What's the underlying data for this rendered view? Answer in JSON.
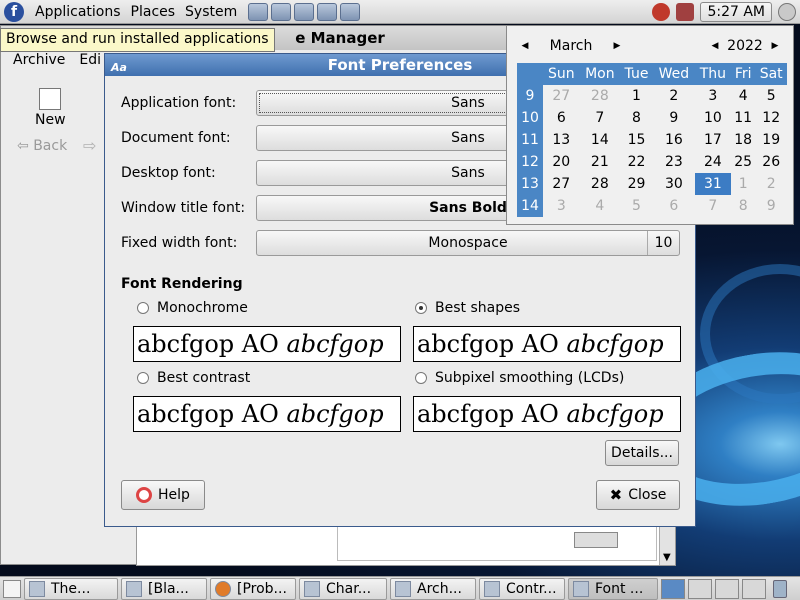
{
  "top_panel": {
    "menus": [
      "Applications",
      "Places",
      "System"
    ],
    "launcher_icons": [
      "web-browser-icon",
      "mail-icon",
      "editor-icon",
      "screen-icon",
      "network-icon"
    ],
    "clock": "5:27 AM"
  },
  "tooltip": "Browse and run installed applications",
  "background_window": {
    "title": "e Manager",
    "menus": [
      "Archive",
      "Edi"
    ],
    "new_label": "New",
    "back_label": "Back"
  },
  "calendar": {
    "month": "March",
    "year": "2022",
    "day_headers": [
      "Sun",
      "Mon",
      "Tue",
      "Wed",
      "Thu",
      "Fri",
      "Sat"
    ],
    "weeks": [
      {
        "num": "9",
        "days": [
          "27",
          "28",
          "1",
          "2",
          "3",
          "4",
          "5"
        ],
        "dim": [
          true,
          true,
          false,
          false,
          false,
          false,
          false
        ]
      },
      {
        "num": "10",
        "days": [
          "6",
          "7",
          "8",
          "9",
          "10",
          "11",
          "12"
        ],
        "dim": [
          false,
          false,
          false,
          false,
          false,
          false,
          false
        ]
      },
      {
        "num": "11",
        "days": [
          "13",
          "14",
          "15",
          "16",
          "17",
          "18",
          "19"
        ],
        "dim": [
          false,
          false,
          false,
          false,
          false,
          false,
          false
        ]
      },
      {
        "num": "12",
        "days": [
          "20",
          "21",
          "22",
          "23",
          "24",
          "25",
          "26"
        ],
        "dim": [
          false,
          false,
          false,
          false,
          false,
          false,
          false
        ]
      },
      {
        "num": "13",
        "days": [
          "27",
          "28",
          "29",
          "30",
          "31",
          "1",
          "2"
        ],
        "dim": [
          false,
          false,
          false,
          false,
          false,
          true,
          true
        ]
      },
      {
        "num": "14",
        "days": [
          "3",
          "4",
          "5",
          "6",
          "7",
          "8",
          "9"
        ],
        "dim": [
          true,
          true,
          true,
          true,
          true,
          true,
          true
        ]
      }
    ],
    "selected_day": "31"
  },
  "dialog": {
    "title": "Font Preferences",
    "fonts": [
      {
        "label": "Application font:",
        "value": "Sans"
      },
      {
        "label": "Document font:",
        "value": "Sans"
      },
      {
        "label": "Desktop font:",
        "value": "Sans"
      },
      {
        "label": "Window title font:",
        "value": "Sans Bold"
      },
      {
        "label": "Fixed width font:",
        "value": "Monospace",
        "size": "10"
      }
    ],
    "rendering_title": "Font Rendering",
    "rendering_options": [
      {
        "label": "Monochrome",
        "selected": false
      },
      {
        "label": "Best shapes",
        "selected": true
      },
      {
        "label": "Best contrast",
        "selected": false
      },
      {
        "label": "Subpixel smoothing (LCDs)",
        "selected": false
      }
    ],
    "preview_text": "abcfgop AO ",
    "preview_italic": "abcfgop",
    "details_label": "Details...",
    "help_label": "Help",
    "close_label": "Close"
  },
  "taskbar": {
    "tasks": [
      "The...",
      "[Bla...",
      "[Prob...",
      "Char...",
      "Arch...",
      "Contr...",
      "Font ..."
    ],
    "active_task": "Font ..."
  }
}
